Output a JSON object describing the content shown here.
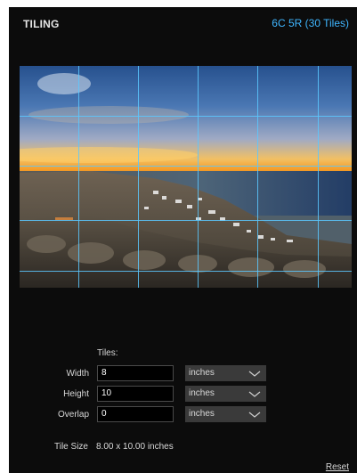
{
  "header": {
    "title": "TILING",
    "tile_info": "6C 5R (30 Tiles)"
  },
  "preview": {
    "image": "sunset-coastal-village-photo",
    "grid": {
      "columns": 6,
      "rows": 5,
      "line_color": "#5ac8ff"
    }
  },
  "settings": {
    "tiles_label": "Tiles:",
    "width": {
      "label": "Width",
      "value": "8",
      "unit": "inches"
    },
    "height": {
      "label": "Height",
      "value": "10",
      "unit": "inches"
    },
    "overlap": {
      "label": "Overlap",
      "value": "0",
      "unit": "inches"
    },
    "tile_size": {
      "label": "Tile Size",
      "value": "8.00 x 10.00 inches"
    }
  },
  "footer": {
    "reset_label": "Reset"
  },
  "colors": {
    "background": "#0c0c0c",
    "accent": "#3fb6ff"
  }
}
